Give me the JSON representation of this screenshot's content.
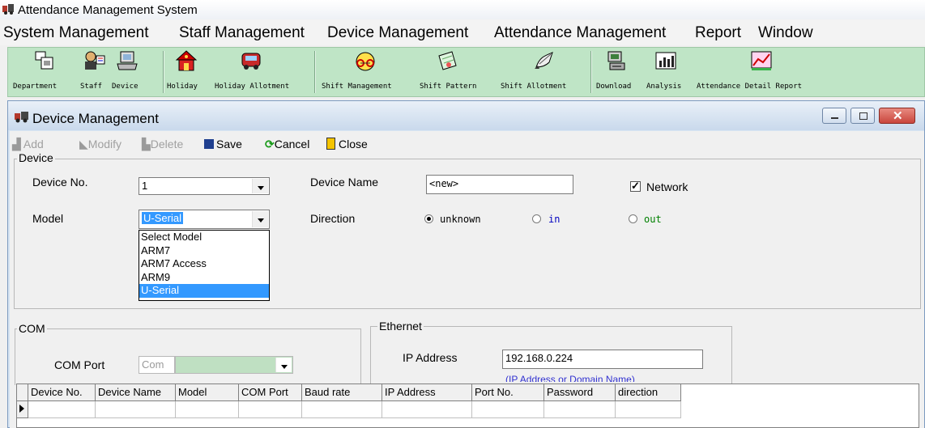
{
  "app": {
    "title": "Attendance Management System"
  },
  "menu": [
    "System Management",
    "Staff Management",
    "Device Management",
    "Attendance Management",
    "Report",
    "Window"
  ],
  "toolbar": {
    "department": "Department",
    "staff": "Staff",
    "device": "Device",
    "holiday": "Holiday",
    "holiday_allotment": "Holiday Allotment",
    "shift_management": "Shift Management",
    "shift_pattern": "Shift Pattern",
    "shift_allotment": "Shift Allotment",
    "download": "Download",
    "analysis": "Analysis",
    "attendance_detail_report": "Attendance Detail Report"
  },
  "window": {
    "title": "Device Management"
  },
  "commands": {
    "add": "Add",
    "modify": "Modify",
    "delete": "Delete",
    "save": "Save",
    "cancel": "Cancel",
    "close": "Close"
  },
  "device": {
    "group_label": "Device",
    "no_label": "Device No.",
    "no_value": "1",
    "name_label": "Device Name",
    "name_value": "<new>",
    "network_label": "Network",
    "network_checked": true,
    "model_label": "Model",
    "model_value": "U-Serial",
    "model_options": [
      "Select Model",
      "ARM7",
      "ARM7 Access",
      "ARM9",
      "U-Serial"
    ],
    "direction_label": "Direction",
    "direction_options": [
      "unknown",
      "in",
      "out"
    ],
    "direction_selected": "unknown"
  },
  "com": {
    "group_label": "COM",
    "port_label": "COM Port",
    "port_prefix": "Com"
  },
  "ethernet": {
    "group_label": "Ethernet",
    "ip_label": "IP Address",
    "ip_value": "192.168.0.224",
    "hint": "(IP Address or Domain Name)"
  },
  "grid": {
    "columns": [
      "Device No.",
      "Device Name",
      "Model",
      "COM Port",
      "Baud rate",
      "IP Address",
      "Port No.",
      "Password",
      "direction"
    ]
  },
  "colors": {
    "toolbar_bg": "#bfe5c6",
    "selection": "#3399ff",
    "radio_label_blue": "#0000c0",
    "radio_label_green": "#008000",
    "close_button": "#c9463d"
  }
}
